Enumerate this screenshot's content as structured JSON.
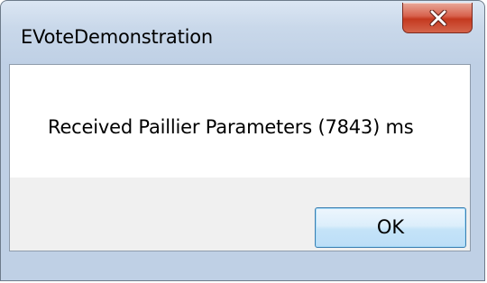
{
  "window": {
    "title": "EVoteDemonstration",
    "close_icon": "close-x-icon"
  },
  "dialog": {
    "message": "Received Paillier Parameters (7843) ms",
    "ok_label": "OK"
  },
  "colors": {
    "title_bar": "#c9d8ea",
    "close_button": "#c4391f",
    "ok_button_border": "#3c7fb1",
    "button_area": "#f0f0f0"
  }
}
